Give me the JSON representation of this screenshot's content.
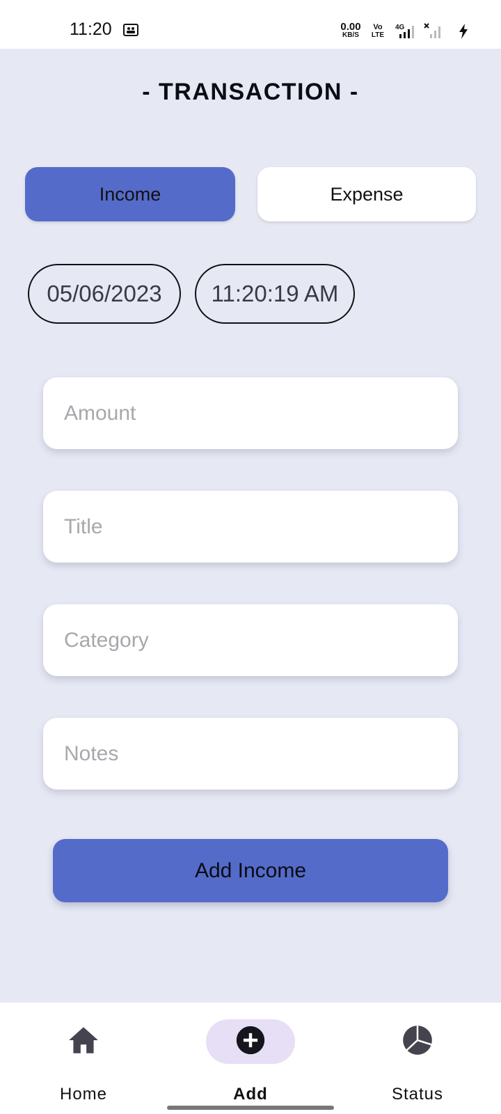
{
  "status_bar": {
    "time": "11:20",
    "net_speed_value": "0.00",
    "net_speed_unit": "KB/S",
    "volte_top": "Vo",
    "volte_bottom": "LTE",
    "network_type": "4G"
  },
  "header": {
    "title": "- TRANSACTION -"
  },
  "type_toggle": {
    "income_label": "Income",
    "expense_label": "Expense",
    "selected": "Income",
    "active_color": "#546bc9"
  },
  "datetime": {
    "date": "05/06/2023",
    "time": "11:20:19 AM"
  },
  "form": {
    "amount_placeholder": "Amount",
    "title_placeholder": "Title",
    "category_placeholder": "Category",
    "notes_placeholder": "Notes",
    "submit_label": "Add Income"
  },
  "bottom_nav": {
    "items": [
      {
        "label": "Home",
        "icon": "home-icon",
        "active": false
      },
      {
        "label": "Add",
        "icon": "add-circle-icon",
        "active": true
      },
      {
        "label": "Status",
        "icon": "pie-chart-icon",
        "active": false
      }
    ],
    "active_pill_color": "#e6dff5"
  },
  "colors": {
    "background": "#e6e8f4",
    "primary": "#546bc9",
    "surface": "#ffffff"
  }
}
